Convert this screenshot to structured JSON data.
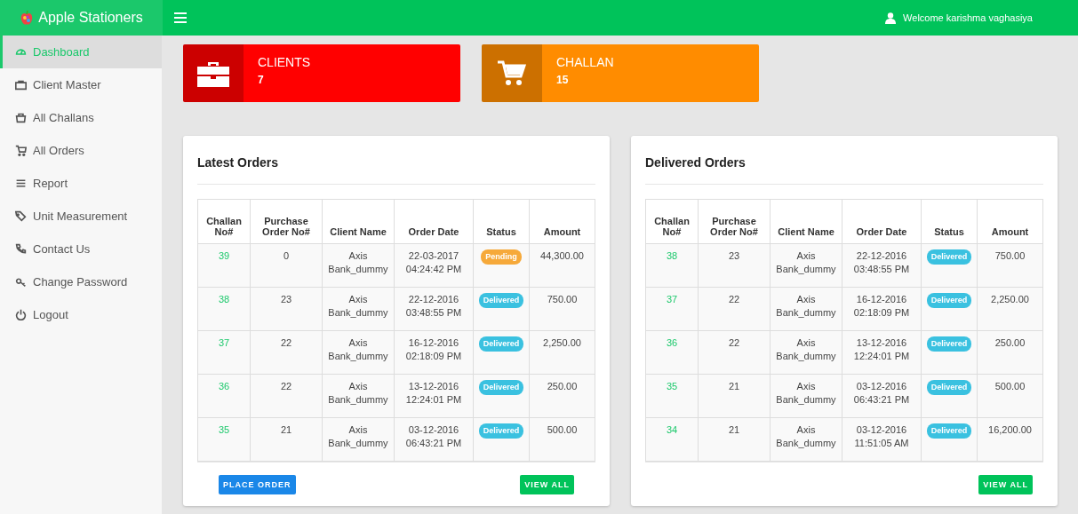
{
  "brand": {
    "name": "Apple Stationers"
  },
  "header": {
    "welcome": "Welcome karishma vaghasiya"
  },
  "sidebar": {
    "items": [
      {
        "label": "Dashboard",
        "selected": true
      },
      {
        "label": "Client Master",
        "selected": false
      },
      {
        "label": "All Challans",
        "selected": false
      },
      {
        "label": "All Orders",
        "selected": false
      },
      {
        "label": "Report",
        "selected": false
      },
      {
        "label": "Unit Measurement",
        "selected": false
      },
      {
        "label": "Contact Us",
        "selected": false
      },
      {
        "label": "Change Password",
        "selected": false
      },
      {
        "label": "Logout",
        "selected": false
      }
    ]
  },
  "stats": [
    {
      "title": "CLIENTS",
      "value": "7",
      "color": "#ff0000"
    },
    {
      "title": "CHALLAN",
      "value": "15",
      "color": "#ff8c00"
    }
  ],
  "panels": [
    {
      "title": "Latest Orders",
      "columns": [
        "Challan No#",
        "Purchase Order No#",
        "Client Name",
        "Order Date",
        "Status",
        "Amount"
      ],
      "rows": [
        {
          "challan": "39",
          "po": "0",
          "client": "Axis Bank_dummy",
          "date": "22-03-2017 04:24:42 PM",
          "status": {
            "label": "Pending",
            "kind": "pending"
          },
          "amount": "44,300.00"
        },
        {
          "challan": "38",
          "po": "23",
          "client": "Axis Bank_dummy",
          "date": "22-12-2016 03:48:55 PM",
          "status": {
            "label": "Delivered",
            "kind": "delivered"
          },
          "amount": "750.00"
        },
        {
          "challan": "37",
          "po": "22",
          "client": "Axis Bank_dummy",
          "date": "16-12-2016 02:18:09 PM",
          "status": {
            "label": "Delivered",
            "kind": "delivered"
          },
          "amount": "2,250.00"
        },
        {
          "challan": "36",
          "po": "22",
          "client": "Axis Bank_dummy",
          "date": "13-12-2016 12:24:01 PM",
          "status": {
            "label": "Delivered",
            "kind": "delivered"
          },
          "amount": "250.00"
        },
        {
          "challan": "35",
          "po": "21",
          "client": "Axis Bank_dummy",
          "date": "03-12-2016 06:43:21 PM",
          "status": {
            "label": "Delivered",
            "kind": "delivered"
          },
          "amount": "500.00"
        }
      ],
      "buttons": [
        {
          "label": "PLACE ORDER",
          "kind": "primary"
        },
        {
          "label": "VIEW ALL",
          "kind": "success"
        }
      ]
    },
    {
      "title": "Delivered Orders",
      "columns": [
        "Challan No#",
        "Purchase Order No#",
        "Client Name",
        "Order Date",
        "Status",
        "Amount"
      ],
      "rows": [
        {
          "challan": "38",
          "po": "23",
          "client": "Axis Bank_dummy",
          "date": "22-12-2016 03:48:55 PM",
          "status": {
            "label": "Delivered",
            "kind": "delivered"
          },
          "amount": "750.00"
        },
        {
          "challan": "37",
          "po": "22",
          "client": "Axis Bank_dummy",
          "date": "16-12-2016 02:18:09 PM",
          "status": {
            "label": "Delivered",
            "kind": "delivered"
          },
          "amount": "2,250.00"
        },
        {
          "challan": "36",
          "po": "22",
          "client": "Axis Bank_dummy",
          "date": "13-12-2016 12:24:01 PM",
          "status": {
            "label": "Delivered",
            "kind": "delivered"
          },
          "amount": "250.00"
        },
        {
          "challan": "35",
          "po": "21",
          "client": "Axis Bank_dummy",
          "date": "03-12-2016 06:43:21 PM",
          "status": {
            "label": "Delivered",
            "kind": "delivered"
          },
          "amount": "500.00"
        },
        {
          "challan": "34",
          "po": "21",
          "client": "Axis Bank_dummy",
          "date": "03-12-2016 11:51:05 AM",
          "status": {
            "label": "Delivered",
            "kind": "delivered"
          },
          "amount": "16,200.00"
        }
      ],
      "buttons": [
        {
          "label": "VIEW ALL",
          "kind": "success"
        }
      ]
    }
  ]
}
